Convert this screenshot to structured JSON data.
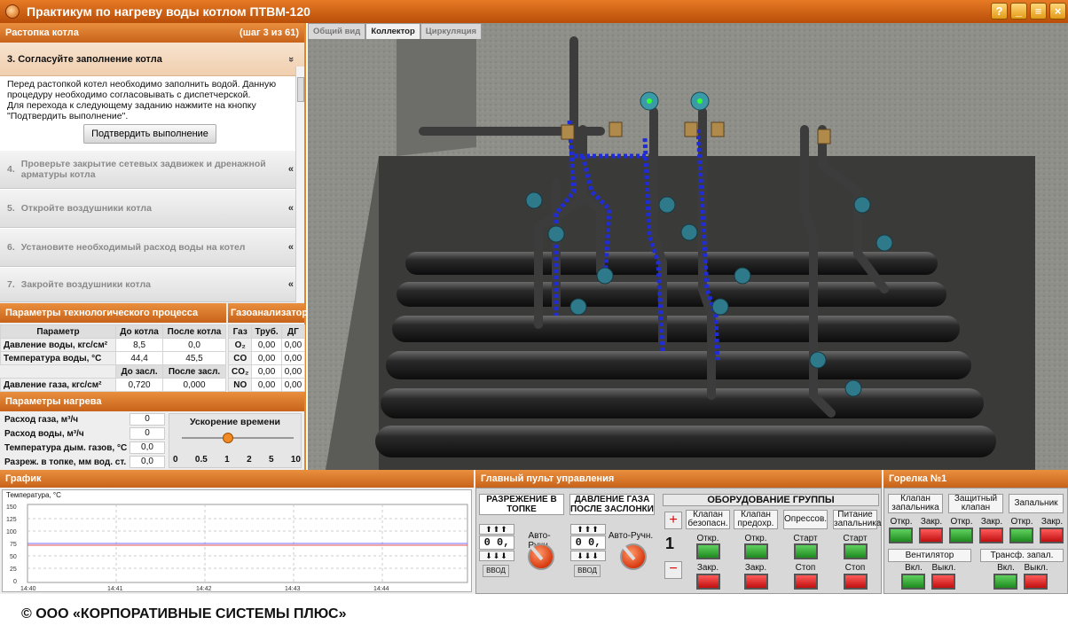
{
  "app": {
    "title": "Практикум по нагреву воды котлом ПТВМ-120"
  },
  "steps": {
    "section": "Растопка котла",
    "counter": "(шаг 3 из 61)",
    "active": {
      "title": "3.  Согласуйте заполнение котла",
      "line1": "Перед растопкой котел необходимо заполнить водой. Данную",
      "line2": "процедуру необходимо согласовывать с диспетчерской.",
      "line3": "Для перехода к следующему заданию нажмите на кнопку",
      "line4": "\"Подтвердить выполнение\".",
      "confirm": "Подтвердить выполнение"
    },
    "items": [
      {
        "num": "4.",
        "label": "Проверьте закрытие сетевых задвижек и дренажной арматуры котла"
      },
      {
        "num": "5.",
        "label": "Откройте воздушники котла"
      },
      {
        "num": "6.",
        "label": "Установите необходимый расход воды на котел"
      },
      {
        "num": "7.",
        "label": "Закройте воздушники котла"
      }
    ],
    "chev_down": "»",
    "chev_left": "«"
  },
  "process": {
    "title": "Параметры технологического процесса",
    "h_param": "Параметр",
    "h_before": "До котла",
    "h_after": "После котла",
    "r1": {
      "name": "Давление воды, кгс/см²",
      "before": "8,5",
      "after": "0,0"
    },
    "r2": {
      "name": "Температура воды, °С",
      "before": "44,4",
      "after": "45,5"
    },
    "h_before2": "До засл.",
    "h_after2": "После засл.",
    "r3": {
      "name": "Давление газа, кгс/см²",
      "before": "0,720",
      "after": "0,000"
    }
  },
  "gas": {
    "title": "Газоанализатор",
    "h_gas": "Газ",
    "h_pipe": "Труб.",
    "h_dg": "ДГ",
    "rows": [
      {
        "gas": "O₂",
        "pipe": "0,00",
        "dg": "0,00"
      },
      {
        "gas": "CO",
        "pipe": "0,00",
        "dg": "0,00"
      },
      {
        "gas": "CO₂",
        "pipe": "0,00",
        "dg": "0,00"
      },
      {
        "gas": "NO",
        "pipe": "0,00",
        "dg": "0,00"
      }
    ]
  },
  "heating": {
    "title": "Параметры нагрева",
    "r1": {
      "label": "Расход газа, м³/ч",
      "value": "0"
    },
    "r2": {
      "label": "Расход воды, м³/ч",
      "value": "0"
    },
    "r3": {
      "label": "Температура дым. газов, °С",
      "value": "0,0"
    },
    "r4": {
      "label": "Разреж. в топке, мм вод. ст.",
      "value": "0,0"
    },
    "speed_title": "Ускорение времени",
    "speed_ticks": [
      "0",
      "0.5",
      "1",
      "2",
      "5",
      "10"
    ],
    "speed_value": "1"
  },
  "view_tabs": {
    "t1": "Общий вид",
    "t2": "Коллектор",
    "t3": "Циркуляция"
  },
  "graph": {
    "title": "График",
    "ylabel": "Температура, °С",
    "yticks": [
      "150",
      "125",
      "100",
      "75",
      "50",
      "25",
      "0"
    ],
    "xticks": [
      "14:40",
      "14:41",
      "14:42",
      "14:43",
      "14:44"
    ]
  },
  "panel": {
    "title": "Главный пульт управления",
    "vac_title": "РАЗРЕЖЕНИЕ В ТОПКЕ",
    "vac_digits": "0 0, 0",
    "gas_title": "ДАВЛЕНИЕ ГАЗА ПОСЛЕ ЗАСЛОНКИ",
    "gas_digits": "0 0, 0",
    "auto_manual": "Авто-Ручн.",
    "input": "ВВОД",
    "group_title": "ОБОРУДОВАНИЕ ГРУППЫ",
    "group_num": "1",
    "plus": "+",
    "minus": "−",
    "eq1": "Клапан безопасн.",
    "eq2": "Клапан предохр.",
    "eq3": "Опрессов.",
    "eq4": "Питание запальника",
    "open": "Откр.",
    "close": "Закр.",
    "start": "Старт",
    "stop": "Стоп",
    "arrows_up": "⬆⬆⬆",
    "arrows_dn": "⬇⬇⬇"
  },
  "burner": {
    "title": "Горелка №1",
    "b1": "Клапан запальника",
    "b2": "Защитный клапан",
    "b3": "Запальник",
    "open": "Откр.",
    "close": "Закр.",
    "fan": "Вентилятор",
    "transf": "Трансф. запал.",
    "on": "Вкл.",
    "off": "Выкл."
  },
  "footer": "© ООО «КОРПОРАТИВНЫЕ СИСТЕМЫ ПЛЮС»",
  "colors": {
    "accent": "#e2862c",
    "green": "#2aa52a",
    "red": "#e01a1a"
  }
}
